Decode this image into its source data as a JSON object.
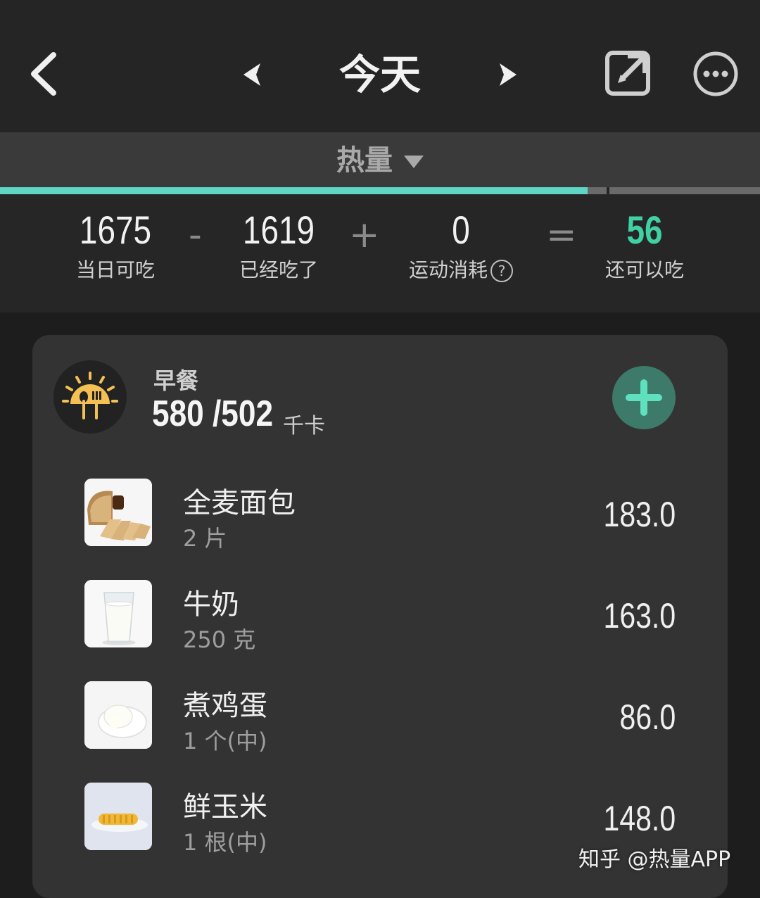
{
  "header": {
    "title": "今天",
    "back_icon": "chevron-left-icon",
    "prev_icon": "caret-left-icon",
    "next_icon": "caret-right-icon",
    "edit_icon": "edit-icon",
    "more_icon": "more-icon"
  },
  "metric": {
    "label": "热量",
    "progress_fraction": 0.773
  },
  "summary": {
    "budget": {
      "value": "1675",
      "label": "当日可吃"
    },
    "minus": "-",
    "eaten": {
      "value": "1619",
      "label": "已经吃了"
    },
    "plus": "+",
    "exercise": {
      "value": "0",
      "label": "运动消耗",
      "help": "?"
    },
    "equals": "=",
    "remaining": {
      "value": "56",
      "label": "还可以吃"
    },
    "accent_color": "#3fd1a3"
  },
  "pager": {
    "count": 8,
    "active_index": 0
  },
  "meal": {
    "name": "早餐",
    "calories": "580 /502",
    "unit": "千卡",
    "icon": "breakfast-icon",
    "add_icon": "plus-icon",
    "items": [
      {
        "name": "全麦面包",
        "amount": "2 片",
        "calories": "183.0",
        "image": "bread"
      },
      {
        "name": "牛奶",
        "amount": "250 克",
        "calories": "163.0",
        "image": "milk"
      },
      {
        "name": "煮鸡蛋",
        "amount": "1 个(中)",
        "calories": "86.0",
        "image": "egg"
      },
      {
        "name": "鲜玉米",
        "amount": "1 根(中)",
        "calories": "148.0",
        "image": "corn"
      }
    ]
  },
  "watermark": "知乎 @热量APP"
}
